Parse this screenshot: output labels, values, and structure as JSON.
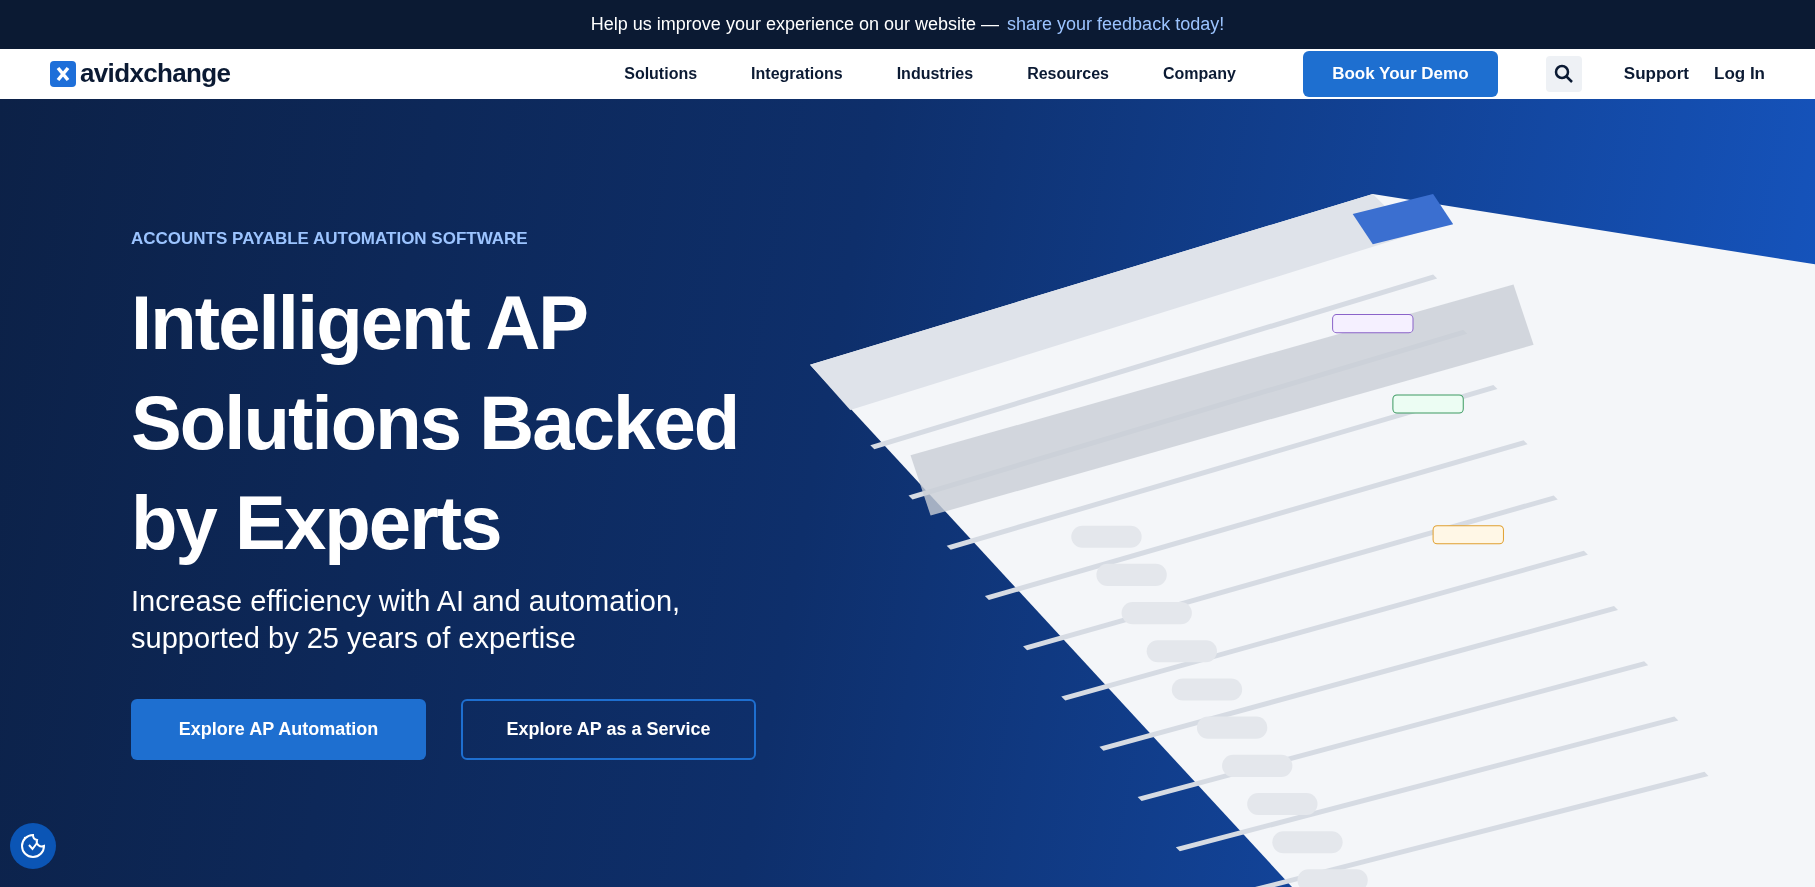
{
  "banner": {
    "text": "Help us improve your experience on our website —",
    "link": "share your feedback today!"
  },
  "nav": {
    "logo": "avidxchange",
    "items": [
      "Solutions",
      "Integrations",
      "Industries",
      "Resources",
      "Company"
    ],
    "cta": "Book Your Demo",
    "links": [
      "Support",
      "Log In"
    ]
  },
  "hero": {
    "eyebrow": "ACCOUNTS PAYABLE AUTOMATION SOFTWARE",
    "title": "Intelligent AP Solutions Backed by Experts",
    "subtitle": "Increase efficiency with AI and automation, supported by 25 years of expertise",
    "buttons": [
      {
        "label": "Explore AP Automation",
        "kind": "primary"
      },
      {
        "label": "Explore AP as a Service",
        "kind": "outline"
      }
    ]
  }
}
